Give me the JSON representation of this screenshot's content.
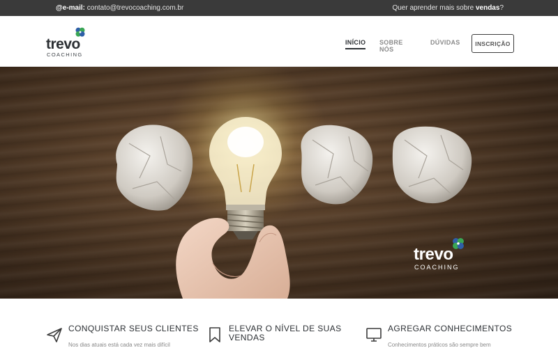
{
  "topbar": {
    "email_label": "@e-mail:",
    "email_value": "contato@trevocoaching.com.br",
    "promo_text": "Quer aprender mais sobre",
    "promo_bold": "vendas",
    "promo_end": "?"
  },
  "brand": {
    "name": "trevo",
    "tagline": "COACHING"
  },
  "nav": {
    "items": [
      {
        "label": "INÍCIO"
      },
      {
        "label": "SOBRE NÓS"
      },
      {
        "label": "DÚVIDAS"
      }
    ],
    "cta_label": "INSCRIÇÃO"
  },
  "hero": {
    "logo_name": "trevo",
    "logo_tagline": "COACHING"
  },
  "features": [
    {
      "icon": "paper-plane-icon",
      "title": "CONQUISTAR SEUS CLIENTES",
      "title2": "",
      "text": "Nos dias atuais está cada vez mais difícil"
    },
    {
      "icon": "bookmark-icon",
      "title": "ELEVAR O NÍVEL DE SUAS",
      "title2": "VENDAS",
      "text": ""
    },
    {
      "icon": "monitor-icon",
      "title": "AGREGAR CONHECIMENTOS",
      "title2": "",
      "text": "Conhecimentos práticos são sempre bem"
    }
  ],
  "colors": {
    "topbar": "#3a3a3a",
    "clover_green": "#3aa655",
    "clover_blue": "#2f5fa8",
    "wood": "#4a3524"
  }
}
